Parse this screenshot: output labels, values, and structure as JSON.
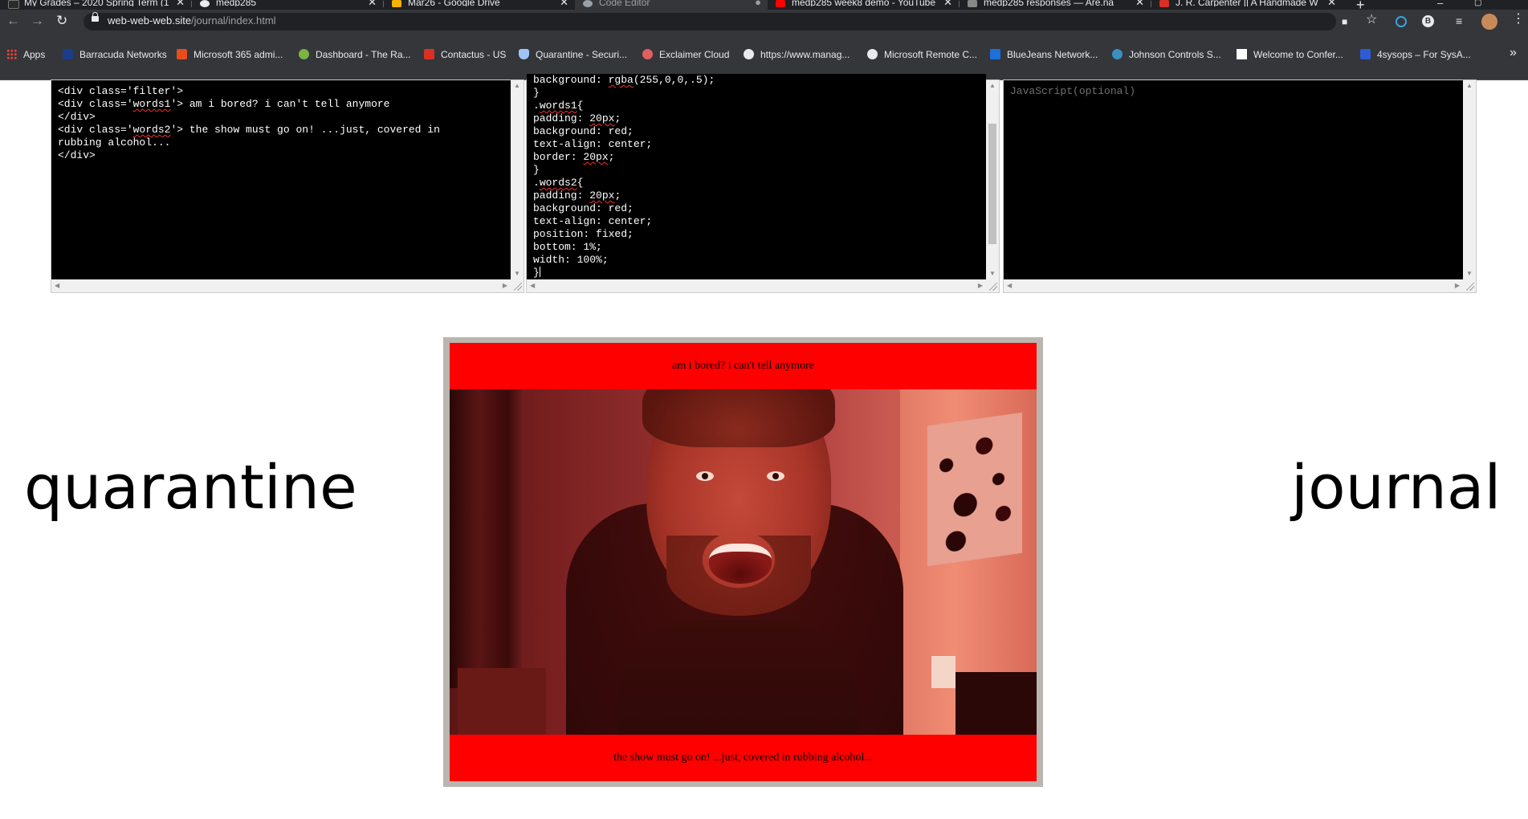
{
  "browser": {
    "tabs": [
      {
        "title": "My Grades – 2020 Spring Term (1",
        "favicon_color": "#2b2b2b",
        "active": false
      },
      {
        "title": "medp285",
        "favicon_color": "#e8eaed",
        "active": false
      },
      {
        "title": "Mar26 - Google Drive",
        "favicon_color": "#f4b400",
        "active": false
      },
      {
        "title": "Code Editor",
        "favicon_color": "#9aa0a6",
        "active": true
      },
      {
        "title": "medp285 week8 demo - YouTube",
        "favicon_color": "#ff0000",
        "active": false
      },
      {
        "title": "medp285 responses — Are.na",
        "favicon_color": "#888888",
        "active": false
      },
      {
        "title": "J. R. Carpenter || A Handmade W",
        "favicon_color": "#d93025",
        "active": false
      }
    ],
    "close_glyph": "✕",
    "new_tab_glyph": "+",
    "url_domain": "web-web-web.site",
    "url_path": "/journal/index.html",
    "bookmarks": [
      {
        "label": "Apps",
        "icon_color": "#ea4335"
      },
      {
        "label": "Barracuda Networks",
        "icon_color": "#1a3c8a"
      },
      {
        "label": "Microsoft 365 admi...",
        "icon_color": "#e74c1c"
      },
      {
        "label": "Dashboard - The Ra...",
        "icon_color": "#7cb342"
      },
      {
        "label": "Contactus - US",
        "icon_color": "#d93025"
      },
      {
        "label": "Quarantine - Securi...",
        "icon_color": "#9fc5f8"
      },
      {
        "label": "Exclaimer Cloud",
        "icon_color": "#e06060"
      },
      {
        "label": "https://www.manag...",
        "icon_color": "#e8eaed"
      },
      {
        "label": "Microsoft Remote C...",
        "icon_color": "#e8eaed"
      },
      {
        "label": "BlueJeans Network...",
        "icon_color": "#1e6fd9"
      },
      {
        "label": "Johnson Controls S...",
        "icon_color": "#3a8fc0"
      },
      {
        "label": "Welcome to Confer...",
        "icon_color": "#ffffff"
      },
      {
        "label": "4sysops – For SysA...",
        "icon_color": "#2f5bd3"
      }
    ],
    "bookmarks_more": "»"
  },
  "editor": {
    "html_lines": [
      "<div class='filter'>",
      "<div class='words1'> am i bored? i can't tell anymore",
      "</div>",
      "<div class='words2'> the show must go on! ...just, covered in",
      "rubbing alcohol...",
      "</div>"
    ],
    "css_lines": [
      "background: rgba(255,0,0,.5);",
      "}",
      ".words1{",
      "padding: 20px;",
      "background: red;",
      "text-align: center;",
      "border: 20px;",
      "}",
      ".words2{",
      "padding: 20px;",
      "background: red;",
      "text-align: center;",
      "position: fixed;",
      "bottom: 1%;",
      "width: 100%;",
      "}"
    ],
    "js_placeholder": "JavaScript(optional)"
  },
  "page": {
    "left_word": "quarantine",
    "right_word": "journal",
    "top_caption": "am i bored? i can't tell anymore",
    "bottom_caption": "the show must go on! ...just, covered in rubbing alcohol...",
    "banner_color": "#ff0000",
    "filter_color": "rgba(255,0,0,.5)"
  }
}
